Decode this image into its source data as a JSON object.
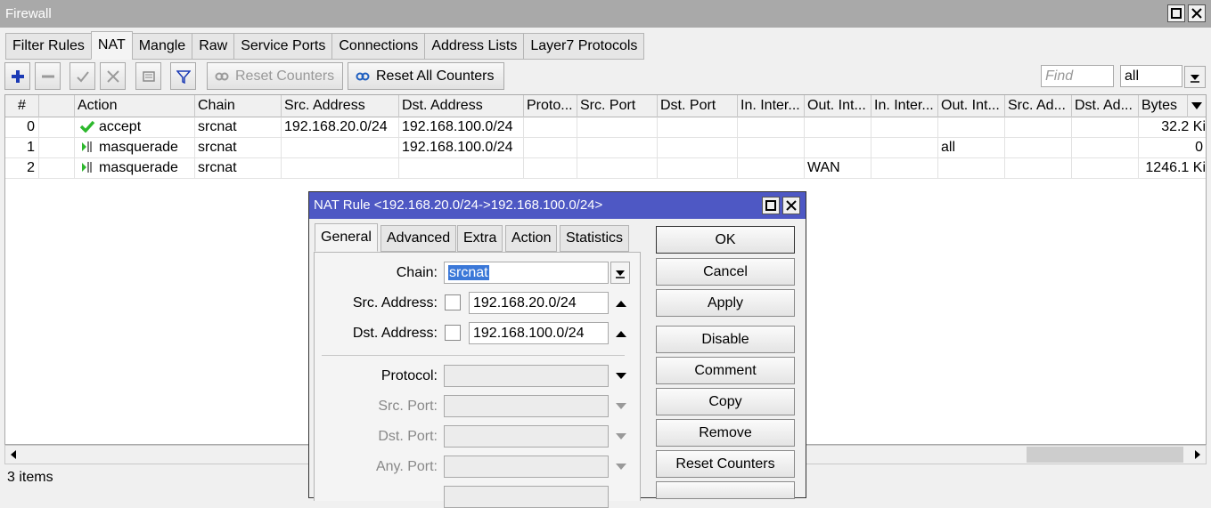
{
  "window": {
    "title": "Firewall"
  },
  "tabs": [
    "Filter Rules",
    "NAT",
    "Mangle",
    "Raw",
    "Service Ports",
    "Connections",
    "Address Lists",
    "Layer7 Protocols"
  ],
  "toolbar": {
    "reset_counters": "Reset Counters",
    "reset_all_counters": "Reset All Counters",
    "find_placeholder": "Find",
    "filter_value": "all"
  },
  "table": {
    "columns": [
      "#",
      "",
      "Action",
      "Chain",
      "Src. Address",
      "Dst. Address",
      "Proto...",
      "Src. Port",
      "Dst. Port",
      "In. Inter...",
      "Out. Int...",
      "In. Inter...",
      "Out. Int...",
      "Src. Ad...",
      "Dst. Ad...",
      "Bytes"
    ],
    "rows": [
      {
        "num": "0",
        "action": "accept",
        "action_icon": "check-icon",
        "chain": "srcnat",
        "src": "192.168.20.0/24",
        "dst": "192.168.100.0/24",
        "out_int": "",
        "out_int_list": "",
        "bytes": "32.2 Ki"
      },
      {
        "num": "1",
        "action": "masquerade",
        "action_icon": "masquerade-icon",
        "chain": "srcnat",
        "src": "",
        "dst": "192.168.100.0/24",
        "out_int": "",
        "out_int_list": "all",
        "bytes": "0"
      },
      {
        "num": "2",
        "action": "masquerade",
        "action_icon": "masquerade-icon",
        "chain": "srcnat",
        "src": "",
        "dst": "",
        "out_int": "WAN",
        "out_int_list": "",
        "bytes": "1246.1 Ki"
      }
    ]
  },
  "status": {
    "items": "3 items"
  },
  "dialog": {
    "title": "NAT Rule <192.168.20.0/24->192.168.100.0/24>",
    "tabs": [
      "General",
      "Advanced",
      "Extra",
      "Action",
      "Statistics"
    ],
    "labels": {
      "chain": "Chain:",
      "src_address": "Src. Address:",
      "dst_address": "Dst. Address:",
      "protocol": "Protocol:",
      "src_port": "Src. Port:",
      "dst_port": "Dst. Port:",
      "any_port": "Any. Port:"
    },
    "values": {
      "chain": "srcnat",
      "src_address": "192.168.20.0/24",
      "dst_address": "192.168.100.0/24"
    },
    "buttons": [
      "OK",
      "Cancel",
      "Apply",
      "Disable",
      "Comment",
      "Copy",
      "Remove",
      "Reset Counters"
    ],
    "colors": {
      "title_bg": "#4e58c4",
      "accept_green": "#2db82d"
    }
  }
}
